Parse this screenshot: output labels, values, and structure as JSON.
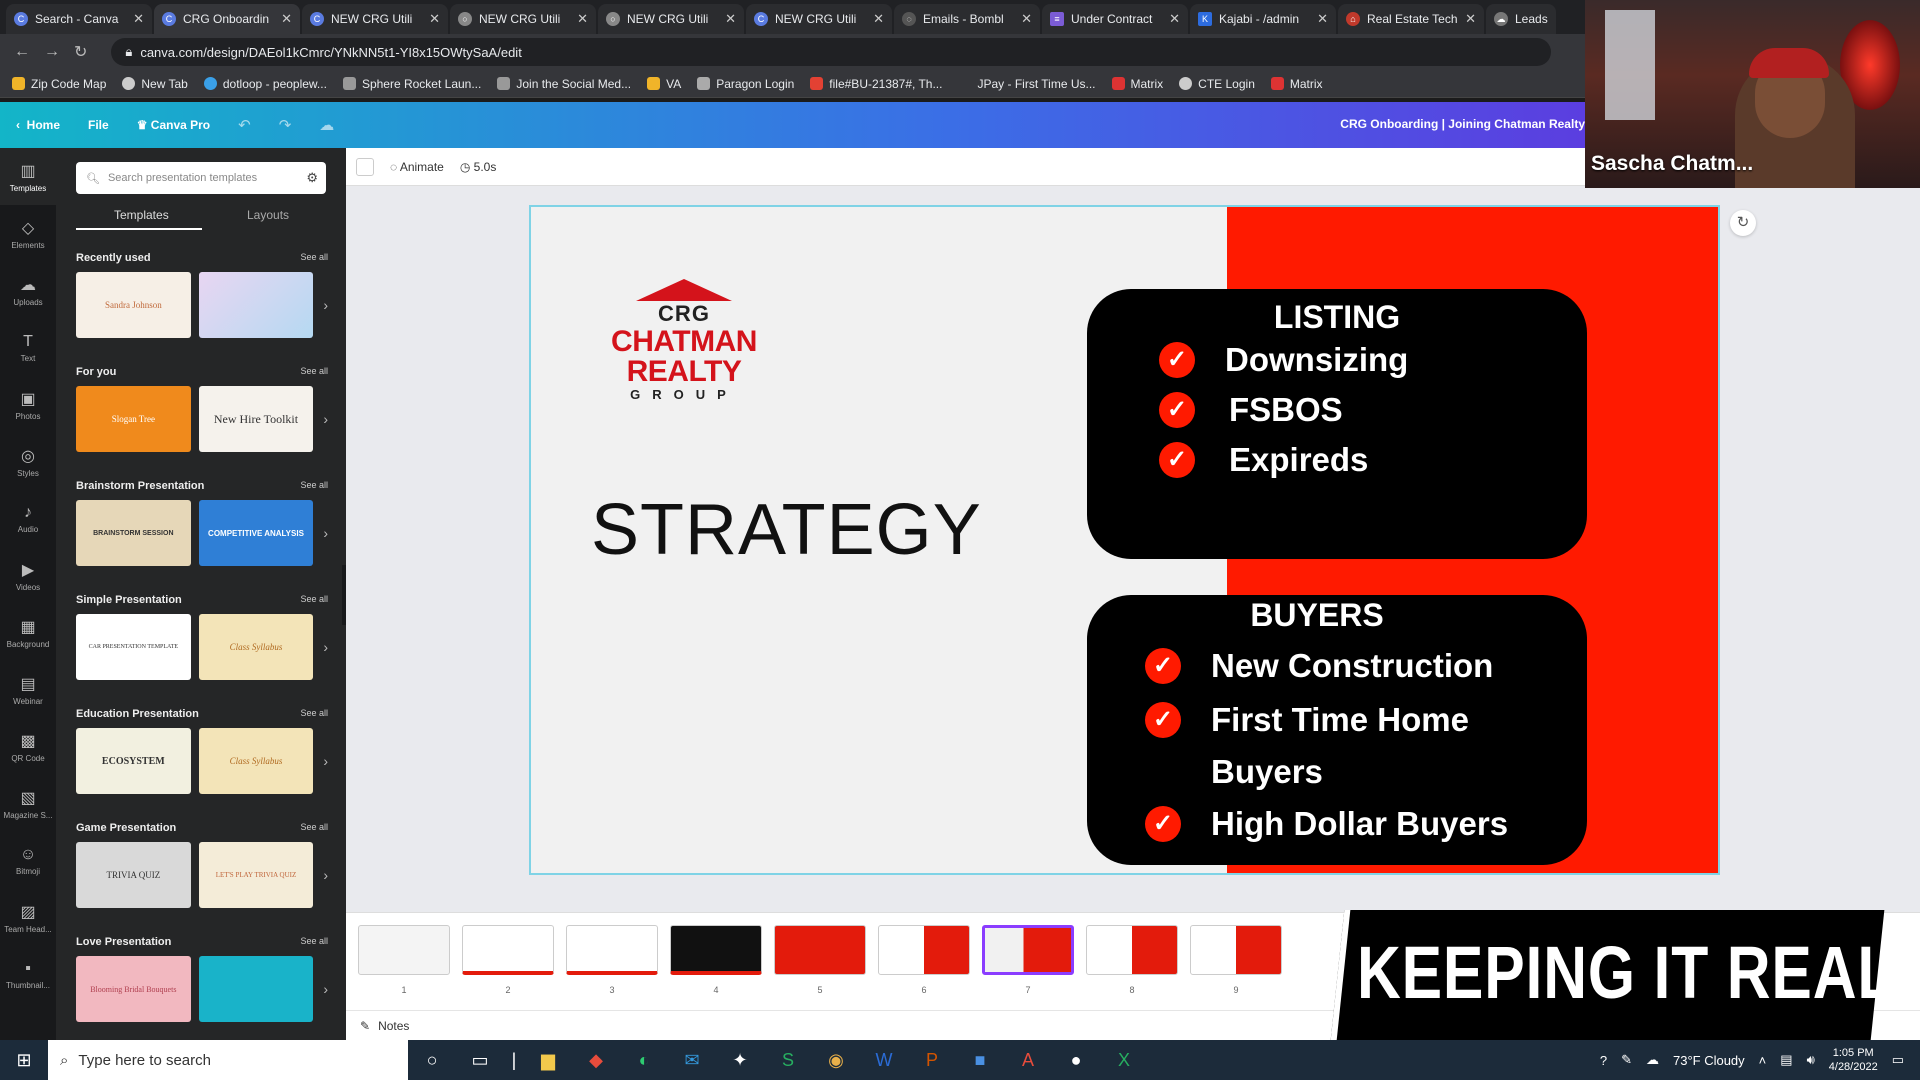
{
  "browser": {
    "tabs": [
      {
        "label": "Search - Canva",
        "active": false
      },
      {
        "label": "CRG Onboardin",
        "active": true
      },
      {
        "label": "NEW CRG Utili",
        "active": false
      },
      {
        "label": "NEW CRG Utili",
        "active": false
      },
      {
        "label": "NEW CRG Utili",
        "active": false
      },
      {
        "label": "NEW CRG Utili",
        "active": false
      },
      {
        "label": "Emails - Bombl",
        "active": false
      },
      {
        "label": "Under Contract",
        "active": false
      },
      {
        "label": "Kajabi - /admin",
        "active": false
      },
      {
        "label": "Real Estate Tech",
        "active": false
      },
      {
        "label": "Leads - P",
        "active": false
      }
    ],
    "url": "canva.com/design/DAEol1kCmrc/YNkNN5t1-YI8x15OWtySaA/edit",
    "bookmarks": [
      "Zip Code Map",
      "New Tab",
      "dotloop - peoplew...",
      "Sphere Rocket Laun...",
      "Join the Social Med...",
      "VA",
      "Paragon Login",
      "file#BU-21387#, Th...",
      "JPay - First Time Us...",
      "Matrix",
      "CTE Login",
      "Matrix"
    ]
  },
  "canva_header": {
    "home": "Home",
    "file": "File",
    "pro": "Canva Pro",
    "doc_title": "CRG Onboarding | Joining Chatman Realty"
  },
  "rail": [
    "Templates",
    "Elements",
    "Uploads",
    "Text",
    "Photos",
    "Styles",
    "Audio",
    "Videos",
    "Background",
    "Webinar",
    "QR Code",
    "Magazine S...",
    "Bitmoji",
    "Team Head...",
    "Thumbnail..."
  ],
  "panel": {
    "search_placeholder": "Search presentation templates",
    "tab_templates": "Templates",
    "tab_layouts": "Layouts",
    "see_all": "See all",
    "sections": [
      {
        "title": "Recently used",
        "thumbs": [
          "Sandra Johnson",
          ""
        ]
      },
      {
        "title": "For you",
        "thumbs": [
          "Slogan Tree",
          "New Hire Toolkit"
        ]
      },
      {
        "title": "Brainstorm Presentation",
        "thumbs": [
          "BRAINSTORM SESSION",
          "COMPETITIVE ANALYSIS"
        ]
      },
      {
        "title": "Simple Presentation",
        "thumbs": [
          "CAR PRESENTATION TEMPLATE",
          "Class Syllabus"
        ]
      },
      {
        "title": "Education Presentation",
        "thumbs": [
          "ECOSYSTEM",
          "Class Syllabus"
        ]
      },
      {
        "title": "Game Presentation",
        "thumbs": [
          "TRIVIA QUIZ",
          "LET'S PLAY TRIVIA QUIZ"
        ]
      },
      {
        "title": "Love Presentation",
        "thumbs": [
          "Blooming Bridal Bouquets",
          ""
        ]
      }
    ]
  },
  "toolbar": {
    "animate": "Animate",
    "duration": "5.0s"
  },
  "slide": {
    "logo_crg": "CRG",
    "logo_name": "CHATMAN REALTY",
    "logo_group": "GROUP",
    "heading": "STRATEGY",
    "listing": {
      "title": "LISTING",
      "items": [
        "Downsizing",
        "FSBOS",
        "Expireds"
      ]
    },
    "buyers": {
      "title": "BUYERS",
      "items": [
        "New Construction",
        "First Time Home",
        "Buyers",
        "High Dollar Buyers"
      ]
    },
    "colors": {
      "red": "#ff1a00",
      "card": "#000000"
    }
  },
  "filmstrip": {
    "page_numbers": [
      "1",
      "2",
      "3",
      "4",
      "5",
      "6",
      "7",
      "8",
      "9"
    ],
    "current": "7"
  },
  "notes_label": "Notes",
  "banner": "KEEPING IT REAL",
  "webcam_name": "Sascha Chatm...",
  "taskbar": {
    "search_placeholder": "Type here to search",
    "weather": "73°F  Cloudy",
    "time": "1:05 PM",
    "date": "4/28/2022"
  }
}
